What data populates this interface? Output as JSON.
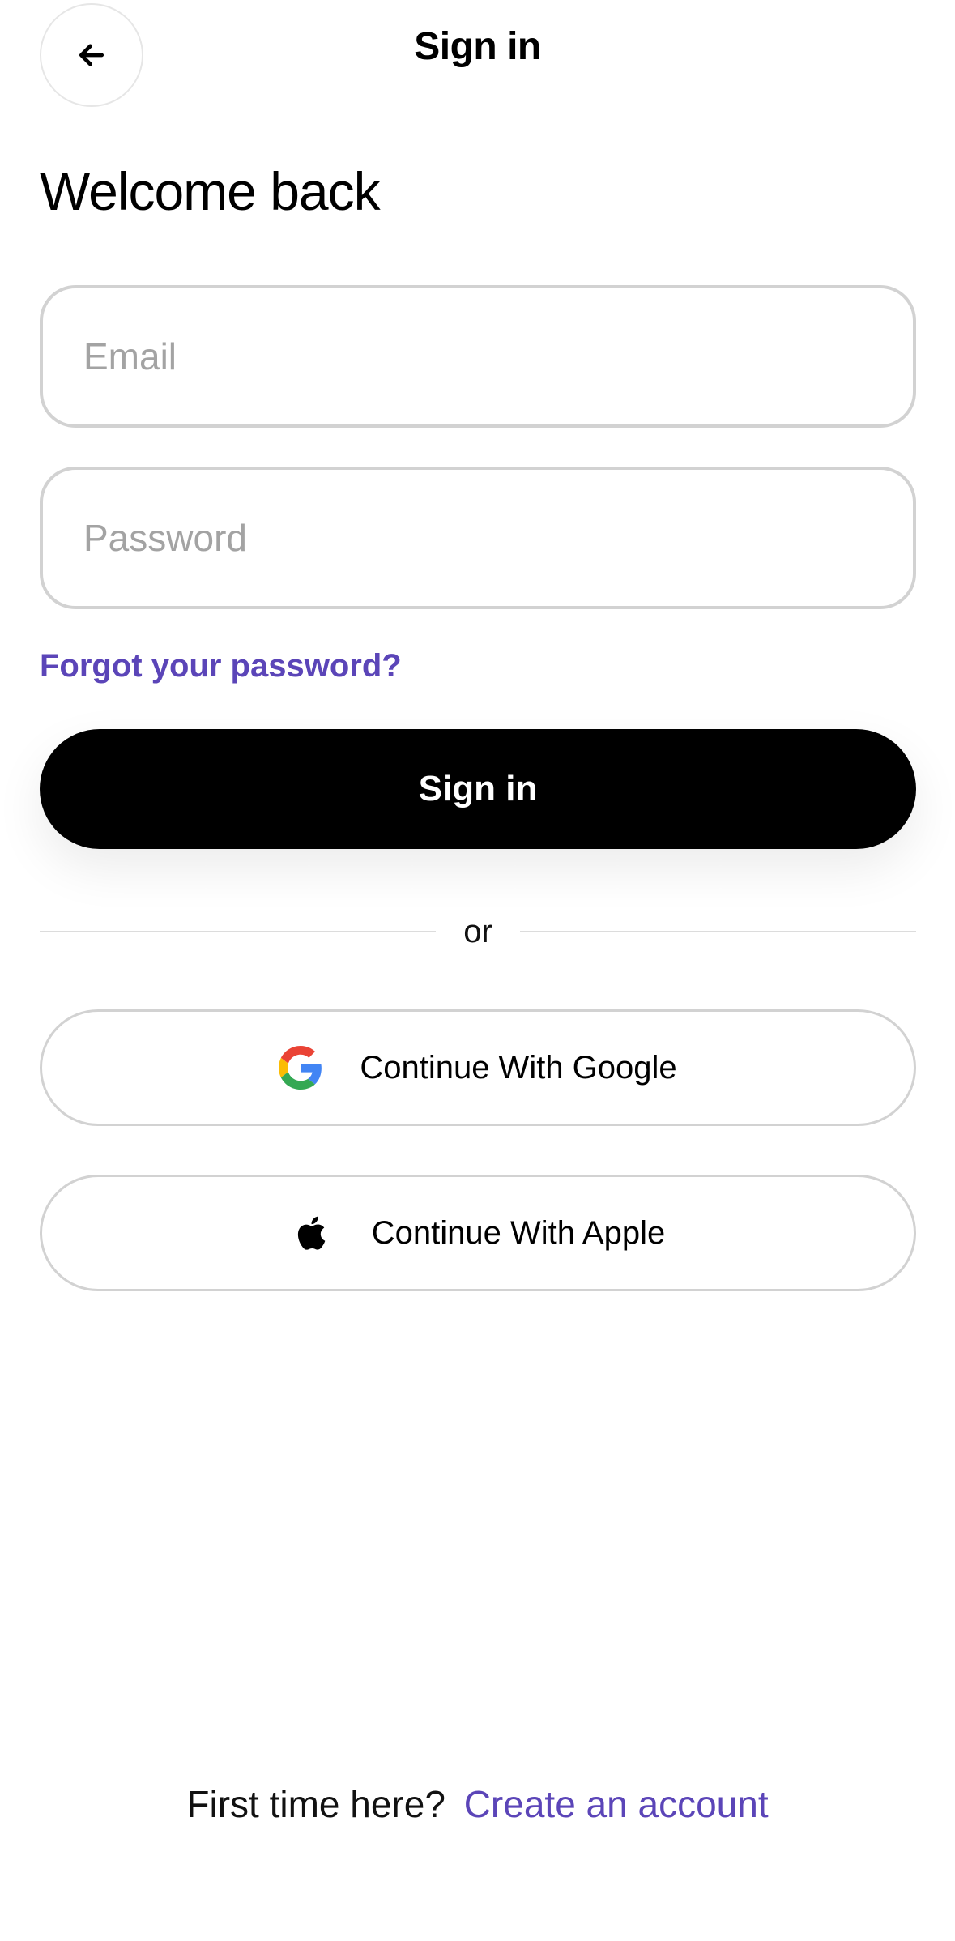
{
  "header": {
    "title": "Sign in",
    "back_icon": "arrow-left-icon"
  },
  "welcome": "Welcome back",
  "form": {
    "email_placeholder": "Email",
    "email_value": "",
    "password_placeholder": "Password",
    "password_value": "",
    "forgot_password": "Forgot your password?",
    "submit_label": "Sign in"
  },
  "divider_text": "or",
  "social": {
    "google_label": "Continue With Google",
    "google_icon": "google-icon",
    "apple_label": "Continue With Apple",
    "apple_icon": "apple-icon"
  },
  "footer": {
    "prompt": "First time here?",
    "link": "Create an account"
  },
  "colors": {
    "accent": "#5b45b8",
    "primary_button": "#000000",
    "border": "#d2d2d2"
  }
}
